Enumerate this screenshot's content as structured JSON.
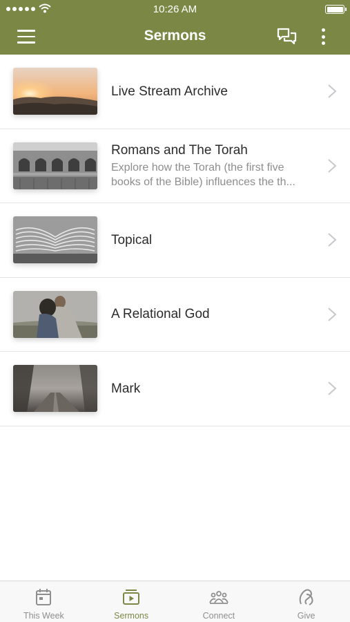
{
  "status_bar": {
    "time": "10:26 AM"
  },
  "header": {
    "title": "Sermons"
  },
  "sermons": [
    {
      "title": "Live Stream Archive",
      "subtitle": "",
      "thumbnail": "sunset-over-mountains"
    },
    {
      "title": "Romans and The Torah",
      "subtitle": "Explore how the Torah (the first five books of the Bible) influences the th...",
      "thumbnail": "colosseum-ruins"
    },
    {
      "title": "Topical",
      "subtitle": "",
      "thumbnail": "open-book-pages"
    },
    {
      "title": "A Relational God",
      "subtitle": "",
      "thumbnail": "embracing-couple"
    },
    {
      "title": "Mark",
      "subtitle": "",
      "thumbnail": "foggy-forest-road"
    }
  ],
  "tabs": [
    {
      "label": "This Week",
      "icon": "calendar-icon",
      "active": false
    },
    {
      "label": "Sermons",
      "icon": "play-video-icon",
      "active": true
    },
    {
      "label": "Connect",
      "icon": "people-group-icon",
      "active": false
    },
    {
      "label": "Give",
      "icon": "give-icon",
      "active": false
    }
  ],
  "colors": {
    "header": "#7b8845",
    "accent": "#7b8845",
    "inactive_tab": "#8e8e8e"
  }
}
